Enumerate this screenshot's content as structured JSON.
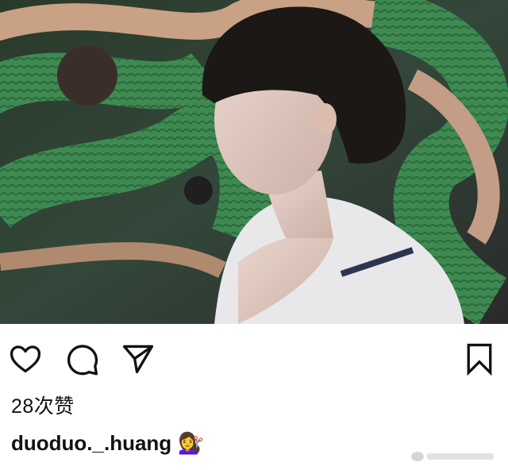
{
  "post": {
    "image_alt": "photo",
    "likes_text": "28次赞",
    "username": "duoduo._.huang",
    "caption_emoji": "💇‍♀️"
  },
  "icons": {
    "like": "heart-icon",
    "comment": "comment-bubble-icon",
    "share": "paper-plane-icon",
    "save": "bookmark-icon"
  },
  "colors": {
    "icon_stroke": "#111111",
    "background": "#ffffff"
  }
}
